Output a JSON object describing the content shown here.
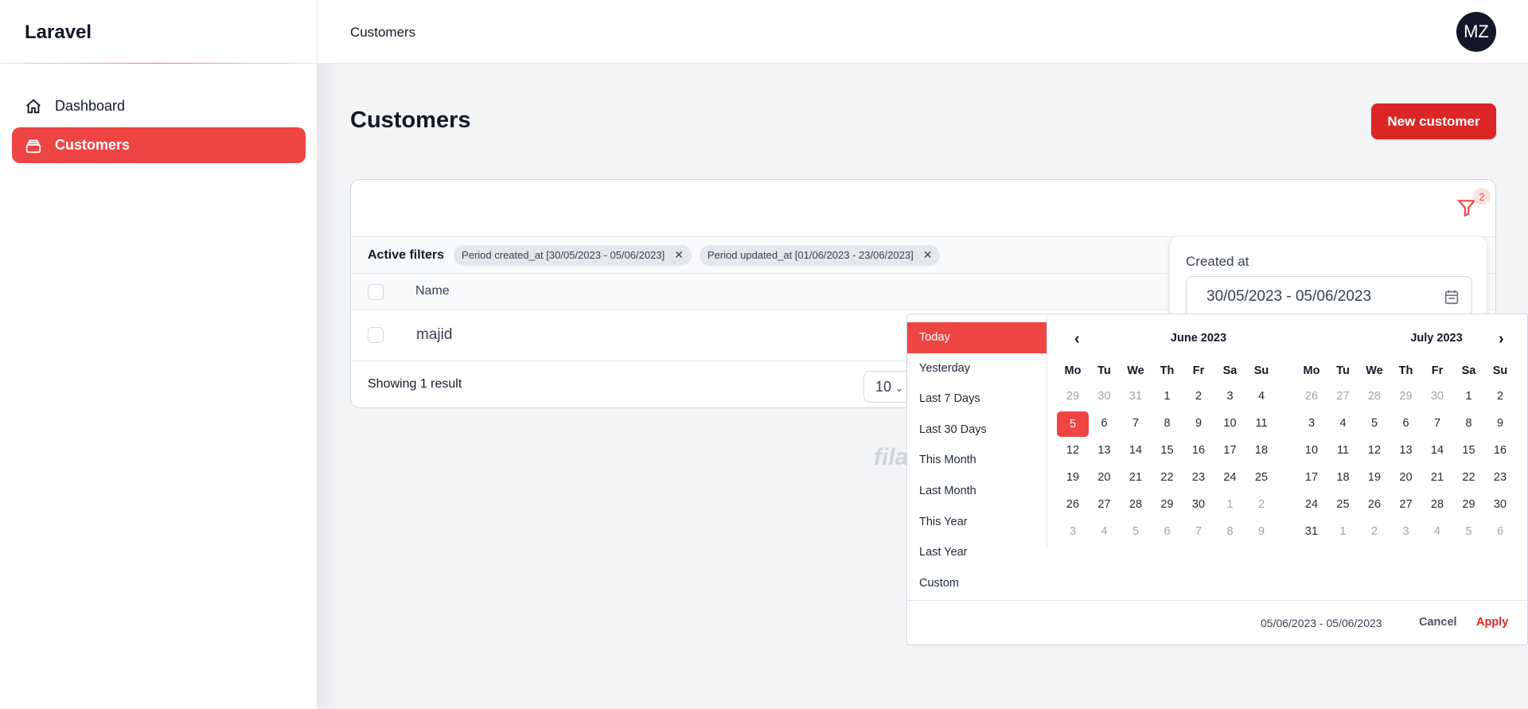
{
  "brand": "Laravel",
  "sidebar": {
    "items": [
      {
        "label": "Dashboard",
        "icon": "home-icon",
        "active": false
      },
      {
        "label": "Customers",
        "icon": "inbox-stack-icon",
        "active": true
      }
    ]
  },
  "header": {
    "breadcrumb": "Customers",
    "avatar_initials": "MZ"
  },
  "page": {
    "title": "Customers",
    "new_button": "New customer"
  },
  "colors": {
    "primary": "#ef4444",
    "button": "#dc2626",
    "avatar": "#111827"
  },
  "table": {
    "filter_count": "2",
    "active_filters_label": "Active filters",
    "filters": [
      "Period created_at [30/05/2023 - 05/06/2023]",
      "Period updated_at [01/06/2023 - 23/06/2023]"
    ],
    "columns": [
      "Name"
    ],
    "rows": [
      {
        "name": "majid"
      }
    ],
    "footer": {
      "results": "Showing 1 result",
      "per_page": "10"
    }
  },
  "watermark": "fila",
  "filter_panel": {
    "label": "Created at",
    "value": "30/05/2023 - 05/06/2023"
  },
  "datepicker": {
    "ranges": [
      "Today",
      "Yesterday",
      "Last 7 Days",
      "Last 30 Days",
      "This Month",
      "Last Month",
      "This Year",
      "Last Year",
      "Custom"
    ],
    "selected_range": "Today",
    "weekdays": [
      "Mo",
      "Tu",
      "We",
      "Th",
      "Fr",
      "Sa",
      "Su"
    ],
    "months": [
      {
        "title": "June 2023",
        "weeks": [
          [
            "29",
            "30",
            "31",
            "1",
            "2",
            "3",
            "4"
          ],
          [
            "5",
            "6",
            "7",
            "8",
            "9",
            "10",
            "11"
          ],
          [
            "12",
            "13",
            "14",
            "15",
            "16",
            "17",
            "18"
          ],
          [
            "19",
            "20",
            "21",
            "22",
            "23",
            "24",
            "25"
          ],
          [
            "26",
            "27",
            "28",
            "29",
            "30",
            "1",
            "2"
          ],
          [
            "3",
            "4",
            "5",
            "6",
            "7",
            "8",
            "9"
          ]
        ],
        "other_month_days": {
          "first_week": [
            "29",
            "30",
            "31"
          ],
          "last_weeks": [
            "1",
            "2",
            "3",
            "4",
            "5",
            "6",
            "7",
            "8",
            "9"
          ]
        },
        "selected_day": "5"
      },
      {
        "title": "July 2023",
        "weeks": [
          [
            "26",
            "27",
            "28",
            "29",
            "30",
            "1",
            "2"
          ],
          [
            "3",
            "4",
            "5",
            "6",
            "7",
            "8",
            "9"
          ],
          [
            "10",
            "11",
            "12",
            "13",
            "14",
            "15",
            "16"
          ],
          [
            "17",
            "18",
            "19",
            "20",
            "21",
            "22",
            "23"
          ],
          [
            "24",
            "25",
            "26",
            "27",
            "28",
            "29",
            "30"
          ],
          [
            "31",
            "1",
            "2",
            "3",
            "4",
            "5",
            "6"
          ]
        ],
        "other_month_days": {
          "first_week": [
            "26",
            "27",
            "28",
            "29",
            "30"
          ],
          "last_weeks": [
            "1",
            "2",
            "3",
            "4",
            "5",
            "6"
          ]
        },
        "selected_day": null
      }
    ],
    "selected_text": "05/06/2023 - 05/06/2023",
    "cancel": "Cancel",
    "apply": "Apply"
  }
}
